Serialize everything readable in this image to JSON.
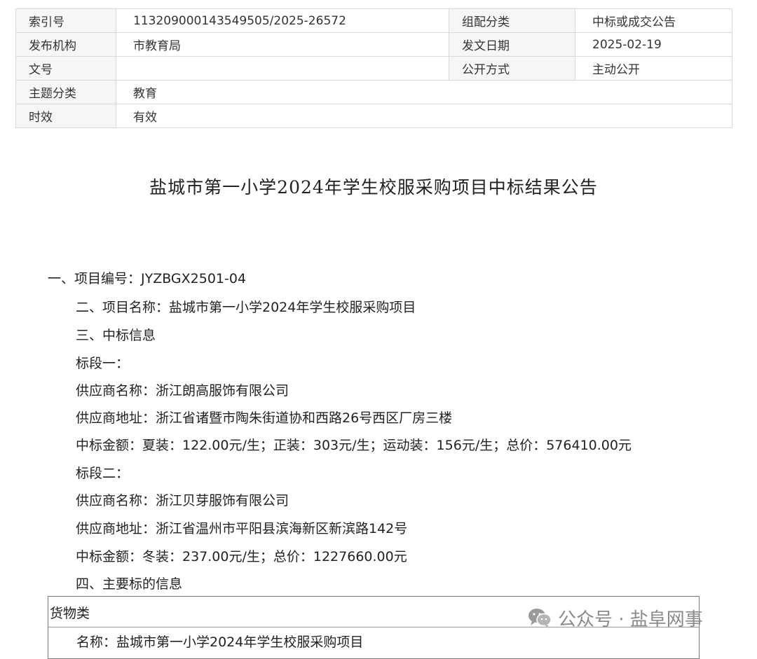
{
  "meta": {
    "rows": [
      {
        "k1": "索引号",
        "v1": "113209000143549505/2025-26572",
        "k2": "组配分类",
        "v2": "中标或成交公告"
      },
      {
        "k1": "发布机构",
        "v1": "市教育局",
        "k2": "发文日期",
        "v2": "2025-02-19"
      },
      {
        "k1": "文号",
        "v1": "",
        "k2": "公开方式",
        "v2": "主动公开"
      },
      {
        "k1": "主题分类",
        "v1": "教育"
      },
      {
        "k1": "时效",
        "v1": "有效"
      }
    ]
  },
  "document": {
    "title": "盐城市第一小学2024年学生校服采购项目中标结果公告",
    "lines": [
      "一、项目编号：JYZBGX2501-04",
      "二、项目名称：盐城市第一小学2024年学生校服采购项目",
      "三、中标信息",
      "标段一：",
      "供应商名称：浙江朗高服饰有限公司",
      "供应商地址：浙江省诸暨市陶朱街道协和西路26号西区厂房三楼",
      "中标金额：夏装：122.00元/生；正装：303元/生；运动装：156元/生；总价：576410.00元",
      "标段二：",
      "供应商名称：浙江贝芽服饰有限公司",
      "供应商地址：浙江省温州市平阳县滨海新区新滨路142号",
      "中标金额：冬装：237.00元/生；总价：1227660.00元",
      "四、主要标的信息"
    ],
    "goods": {
      "header": "货物类",
      "name_line": "名称：盐城市第一小学2024年学生校服采购项目"
    }
  },
  "watermark": {
    "text": "公众号 · 盐阜网事",
    "icon": "wechat-icon",
    "color": "#8a8a8a"
  }
}
